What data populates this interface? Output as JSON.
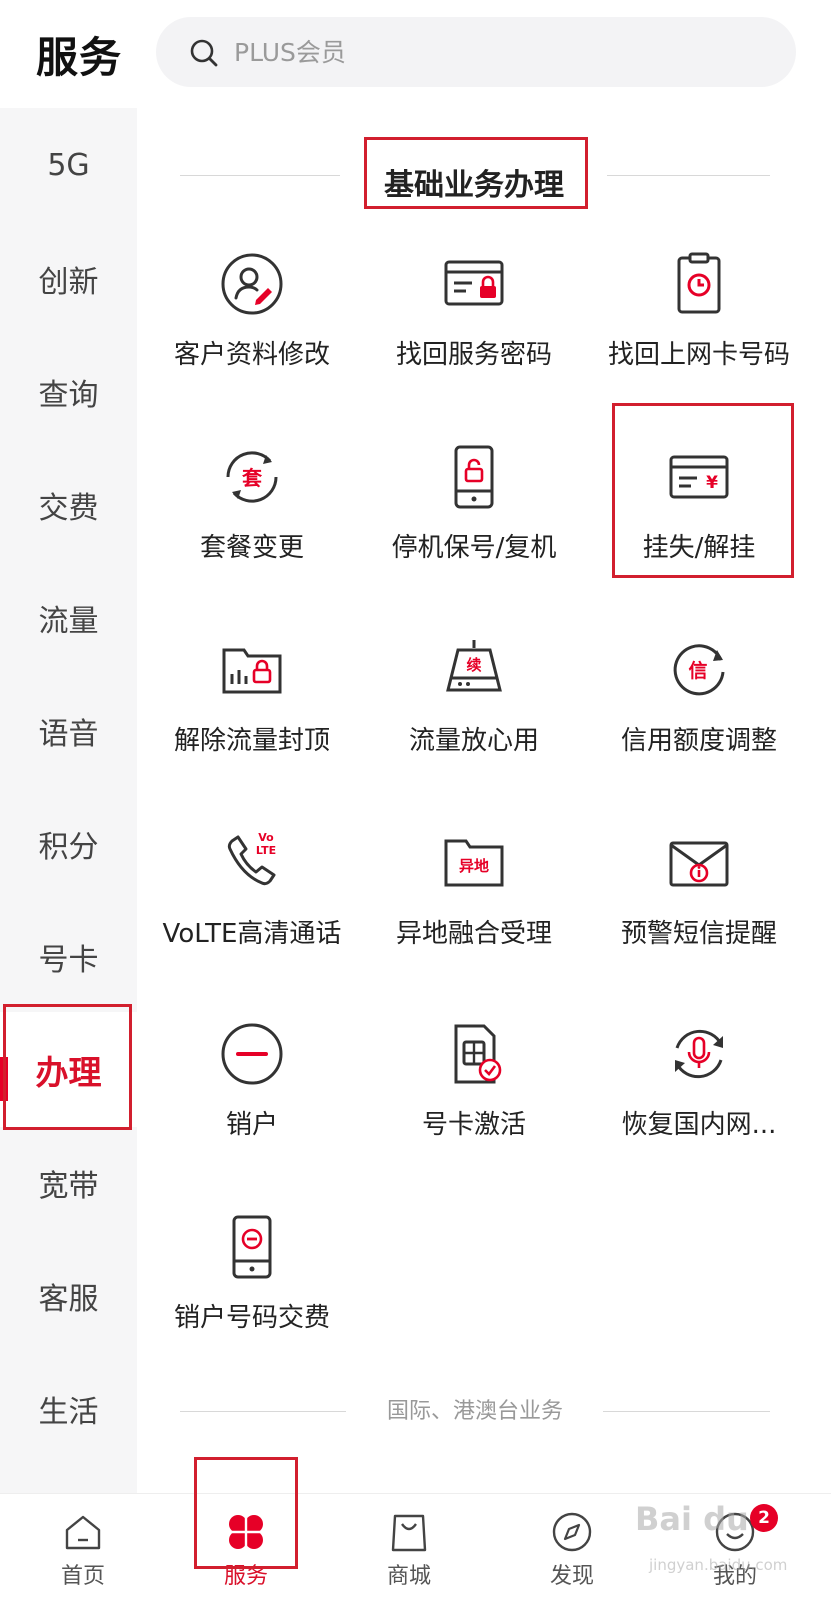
{
  "header": {
    "title": "服务",
    "search_placeholder": "PLUS会员"
  },
  "sidebar": {
    "items": [
      {
        "label": "5G"
      },
      {
        "label": "创新"
      },
      {
        "label": "查询"
      },
      {
        "label": "交费"
      },
      {
        "label": "流量"
      },
      {
        "label": "语音"
      },
      {
        "label": "积分"
      },
      {
        "label": "号卡"
      },
      {
        "label": "办理",
        "active": true
      },
      {
        "label": "宽带"
      },
      {
        "label": "客服"
      },
      {
        "label": "生活"
      }
    ]
  },
  "main": {
    "section_title": "基础业务办理",
    "tiles": [
      {
        "label": "客户资料修改",
        "icon": "user-edit-icon"
      },
      {
        "label": "找回服务密码",
        "icon": "card-lock-icon"
      },
      {
        "label": "找回上网卡号码",
        "icon": "clipboard-clock-icon"
      },
      {
        "label": "套餐变更",
        "icon": "package-change-icon",
        "glyph": "套"
      },
      {
        "label": "停机保号/复机",
        "icon": "phone-lock-icon"
      },
      {
        "label": "挂失/解挂",
        "icon": "card-yen-icon",
        "glyph": "¥"
      },
      {
        "label": "解除流量封顶",
        "icon": "folder-chart-lock-icon"
      },
      {
        "label": "流量放心用",
        "icon": "router-icon",
        "glyph": "续"
      },
      {
        "label": "信用额度调整",
        "icon": "credit-refresh-icon",
        "glyph": "信"
      },
      {
        "label": "VoLTE高清通话",
        "icon": "volte-phone-icon",
        "glyph_top": "Vo",
        "glyph_bottom": "LTE"
      },
      {
        "label": "异地融合受理",
        "icon": "folder-remote-icon",
        "glyph": "异地"
      },
      {
        "label": "预警短信提醒",
        "icon": "envelope-alert-icon"
      },
      {
        "label": "销户",
        "icon": "minus-circle-icon"
      },
      {
        "label": "号卡激活",
        "icon": "sim-check-icon"
      },
      {
        "label": "恢复国内网...",
        "icon": "mic-refresh-icon"
      },
      {
        "label": "销户号码交费",
        "icon": "phone-minus-icon"
      }
    ],
    "sub_section_title": "国际、港澳台业务"
  },
  "bottom_nav": {
    "items": [
      {
        "label": "首页",
        "icon": "home-icon"
      },
      {
        "label": "服务",
        "icon": "clover-icon",
        "active": true
      },
      {
        "label": "商城",
        "icon": "shopping-bag-icon"
      },
      {
        "label": "发现",
        "icon": "compass-icon"
      },
      {
        "label": "我的",
        "icon": "smiley-icon",
        "badge": "2"
      }
    ]
  },
  "watermark": {
    "text": "Bai du",
    "sub": "jingyan.baidu.com"
  },
  "colors": {
    "accent": "#e60027",
    "highlight_box": "#d21f2e",
    "sidebar_bg": "#f6f6f7"
  }
}
